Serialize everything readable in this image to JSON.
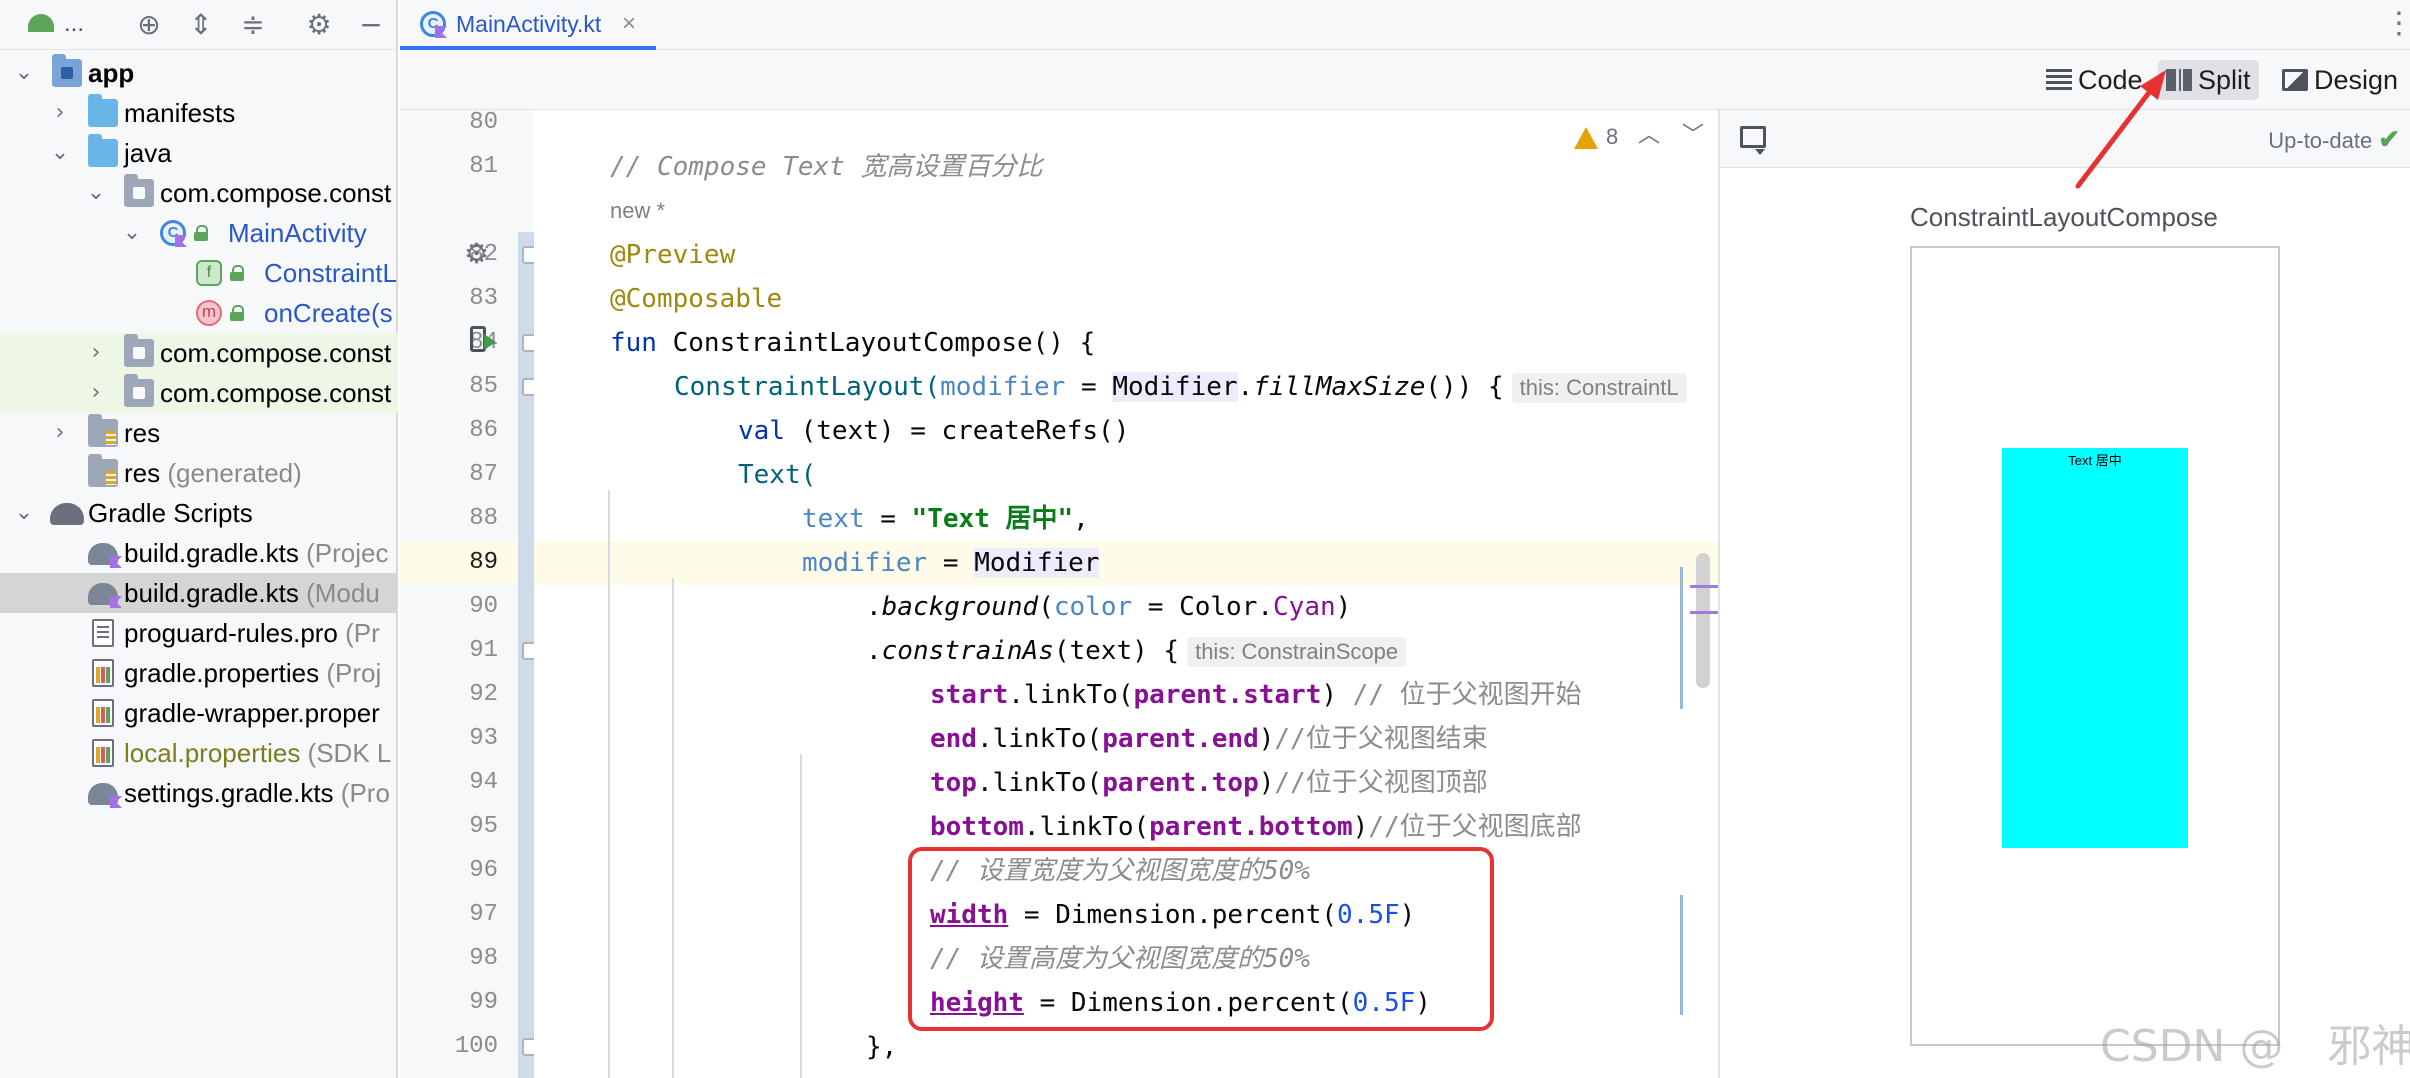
{
  "project_panel": {
    "title": "...",
    "rows": [
      {
        "label": "app",
        "extra": ""
      },
      {
        "label": "manifests",
        "extra": ""
      },
      {
        "label": "java",
        "extra": ""
      },
      {
        "label": "com.compose.const",
        "extra": ""
      },
      {
        "label": "MainActivity",
        "extra": ""
      },
      {
        "label": "ConstraintL",
        "extra": ""
      },
      {
        "label": "onCreate(s",
        "extra": ""
      },
      {
        "label": "com.compose.const",
        "extra": ""
      },
      {
        "label": "com.compose.const",
        "extra": ""
      },
      {
        "label": "res",
        "extra": ""
      },
      {
        "label": "res",
        "extra": " (generated)"
      },
      {
        "label": "Gradle Scripts",
        "extra": ""
      },
      {
        "label": "build.gradle.kts",
        "extra": " (Projec"
      },
      {
        "label": "build.gradle.kts",
        "extra": " (Modu"
      },
      {
        "label": "proguard-rules.pro",
        "extra": " (Pr"
      },
      {
        "label": "gradle.properties",
        "extra": " (Proj"
      },
      {
        "label": "gradle-wrapper.proper",
        "extra": ""
      },
      {
        "label": "local.properties",
        "extra": " (SDK L"
      },
      {
        "label": "settings.gradle.kts",
        "extra": " (Pro"
      }
    ]
  },
  "tab": {
    "label": "MainActivity.kt",
    "close": "×"
  },
  "view_modes": {
    "code": "Code",
    "split": "Split",
    "design": "Design"
  },
  "inspection": {
    "warnings": "8"
  },
  "line_numbers": [
    "80",
    "81",
    "",
    "82",
    "83",
    "84",
    "85",
    "86",
    "87",
    "88",
    "89",
    "90",
    "91",
    "92",
    "93",
    "94",
    "95",
    "96",
    "97",
    "98",
    "99",
    "100"
  ],
  "code": {
    "l81": "// Compose Text 宽高设置百分比",
    "new_marker": "new *",
    "l82": "@Preview",
    "l83": "@Composable",
    "l84_kw": "fun ",
    "l84_rest": "ConstraintLayoutCompose() {",
    "l85_fn": "ConstraintLayout(",
    "l85_param": "modifier",
    "l85_eq": " = ",
    "l85_mod": "Modifier",
    "l85_dot": ".",
    "l85_call": "fillMaxSize",
    "l85_tail": "()) {",
    "l85_hint": "this: ConstraintL",
    "l86_kw": "val ",
    "l86_rest": "(text) = createRefs()",
    "l87": "Text(",
    "l88_param": "text",
    "l88_eq": " = ",
    "l88_str": "\"Text 居中\"",
    "l88_tail": ",",
    "l89_param": "modifier",
    "l89_eq": " = ",
    "l89_mod": "Modifier",
    "l90_dot": ".",
    "l90_call": "background",
    "l90_open": "(",
    "l90_param": "color",
    "l90_eq": " = Color.",
    "l90_val": "Cyan",
    "l90_close": ")",
    "l91_dot": ".",
    "l91_call": "constrainAs",
    "l91_rest": "(text) {",
    "l91_hint": "this: ConstrainScope",
    "l92_a": "start",
    "l92_b": ".linkTo(",
    "l92_c": "parent.start",
    "l92_d": ") ",
    "l92_cm": "// 位于父视图开始",
    "l93_a": "end",
    "l93_b": ".linkTo(",
    "l93_c": "parent.end",
    "l93_d": ")",
    "l93_cm": "//位于父视图结束",
    "l94_a": "top",
    "l94_b": ".linkTo(",
    "l94_c": "parent.top",
    "l94_d": ")",
    "l94_cm": "//位于父视图顶部",
    "l95_a": "bottom",
    "l95_b": ".linkTo(",
    "l95_c": "parent.bottom",
    "l95_d": ")",
    "l95_cm": "//位于父视图底部",
    "l96": "// 设置宽度为父视图宽度的50%",
    "l97_a": "width",
    "l97_b": " = Dimension.percent(",
    "l97_num": "0.5F",
    "l97_c": ")",
    "l98": "// 设置高度为父视图宽度的50%",
    "l99_a": "height",
    "l99_b": " = Dimension.percent(",
    "l99_num": "0.5F",
    "l99_c": ")",
    "l100": "},"
  },
  "preview": {
    "status": "Up-to-date",
    "title": "ConstraintLayoutCompose",
    "text": "Text 居中",
    "text_background": "#00FFFF"
  },
  "watermark": "CSDN @　邪神",
  "colors": {
    "accent": "#3574f0",
    "highlight_box": "#e63232",
    "arrow": "#e63232"
  }
}
